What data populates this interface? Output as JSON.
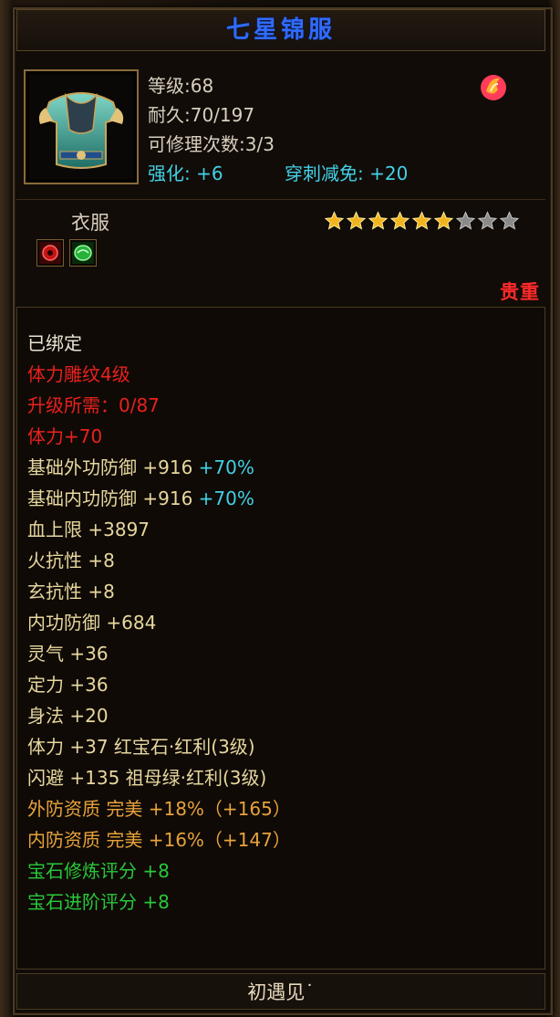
{
  "item": {
    "name": "七星锦服",
    "level_line": "等级:68",
    "durability_line": "耐久:70/197",
    "repair_line": "可修理次数:3/3",
    "enhance_line": "强化: +6",
    "pierce_line": "穿刺减免: +20",
    "category": "衣服",
    "rarity": "贵重",
    "stars_filled": 6,
    "stars_total": 9
  },
  "attributes": [
    {
      "text": "已绑定",
      "color": "white"
    },
    {
      "text": "体力雕纹4级",
      "color": "red"
    },
    {
      "text": "升级所需：0/87",
      "color": "red"
    },
    {
      "text": "体力+70",
      "color": "red"
    },
    {
      "text": "基础外功防御 +916",
      "extra": "+70%",
      "color": "gold"
    },
    {
      "text": "基础内功防御 +916",
      "extra": "+70%",
      "color": "gold"
    },
    {
      "text": "血上限 +3897",
      "color": "gold"
    },
    {
      "text": "火抗性 +8",
      "color": "gold"
    },
    {
      "text": "玄抗性 +8",
      "color": "gold"
    },
    {
      "text": "内功防御 +684",
      "color": "gold"
    },
    {
      "text": "灵气 +36",
      "color": "gold"
    },
    {
      "text": "定力 +36",
      "color": "gold"
    },
    {
      "text": "身法 +20",
      "color": "gold"
    },
    {
      "text": "体力 +37 红宝石·红利(3级)",
      "color": "gold"
    },
    {
      "text": "闪避 +135 祖母绿·红利(3级)",
      "color": "gold"
    },
    {
      "text": "外防资质  完美 +18%（+165）",
      "color": "orange"
    },
    {
      "text": "内防资质  完美 +16%（+147）",
      "color": "orange"
    },
    {
      "text": "宝石修炼评分 +8",
      "color": "green"
    },
    {
      "text": "宝石进阶评分 +8",
      "color": "green"
    }
  ],
  "footer": "初遇见˙",
  "icons": {
    "item": "armor-icon",
    "badge": "flame-badge-icon",
    "gem_slot_1": "red-gem-icon",
    "gem_slot_2": "green-gem-icon"
  },
  "colors": {
    "title": "#2f6bff",
    "cyan": "#43d0e6",
    "red": "#e8211d",
    "gold": "#e7d79e",
    "orange": "#e7a23c",
    "green": "#28c83a",
    "white": "#ece4d6",
    "rarity": "#ff2a2a"
  }
}
